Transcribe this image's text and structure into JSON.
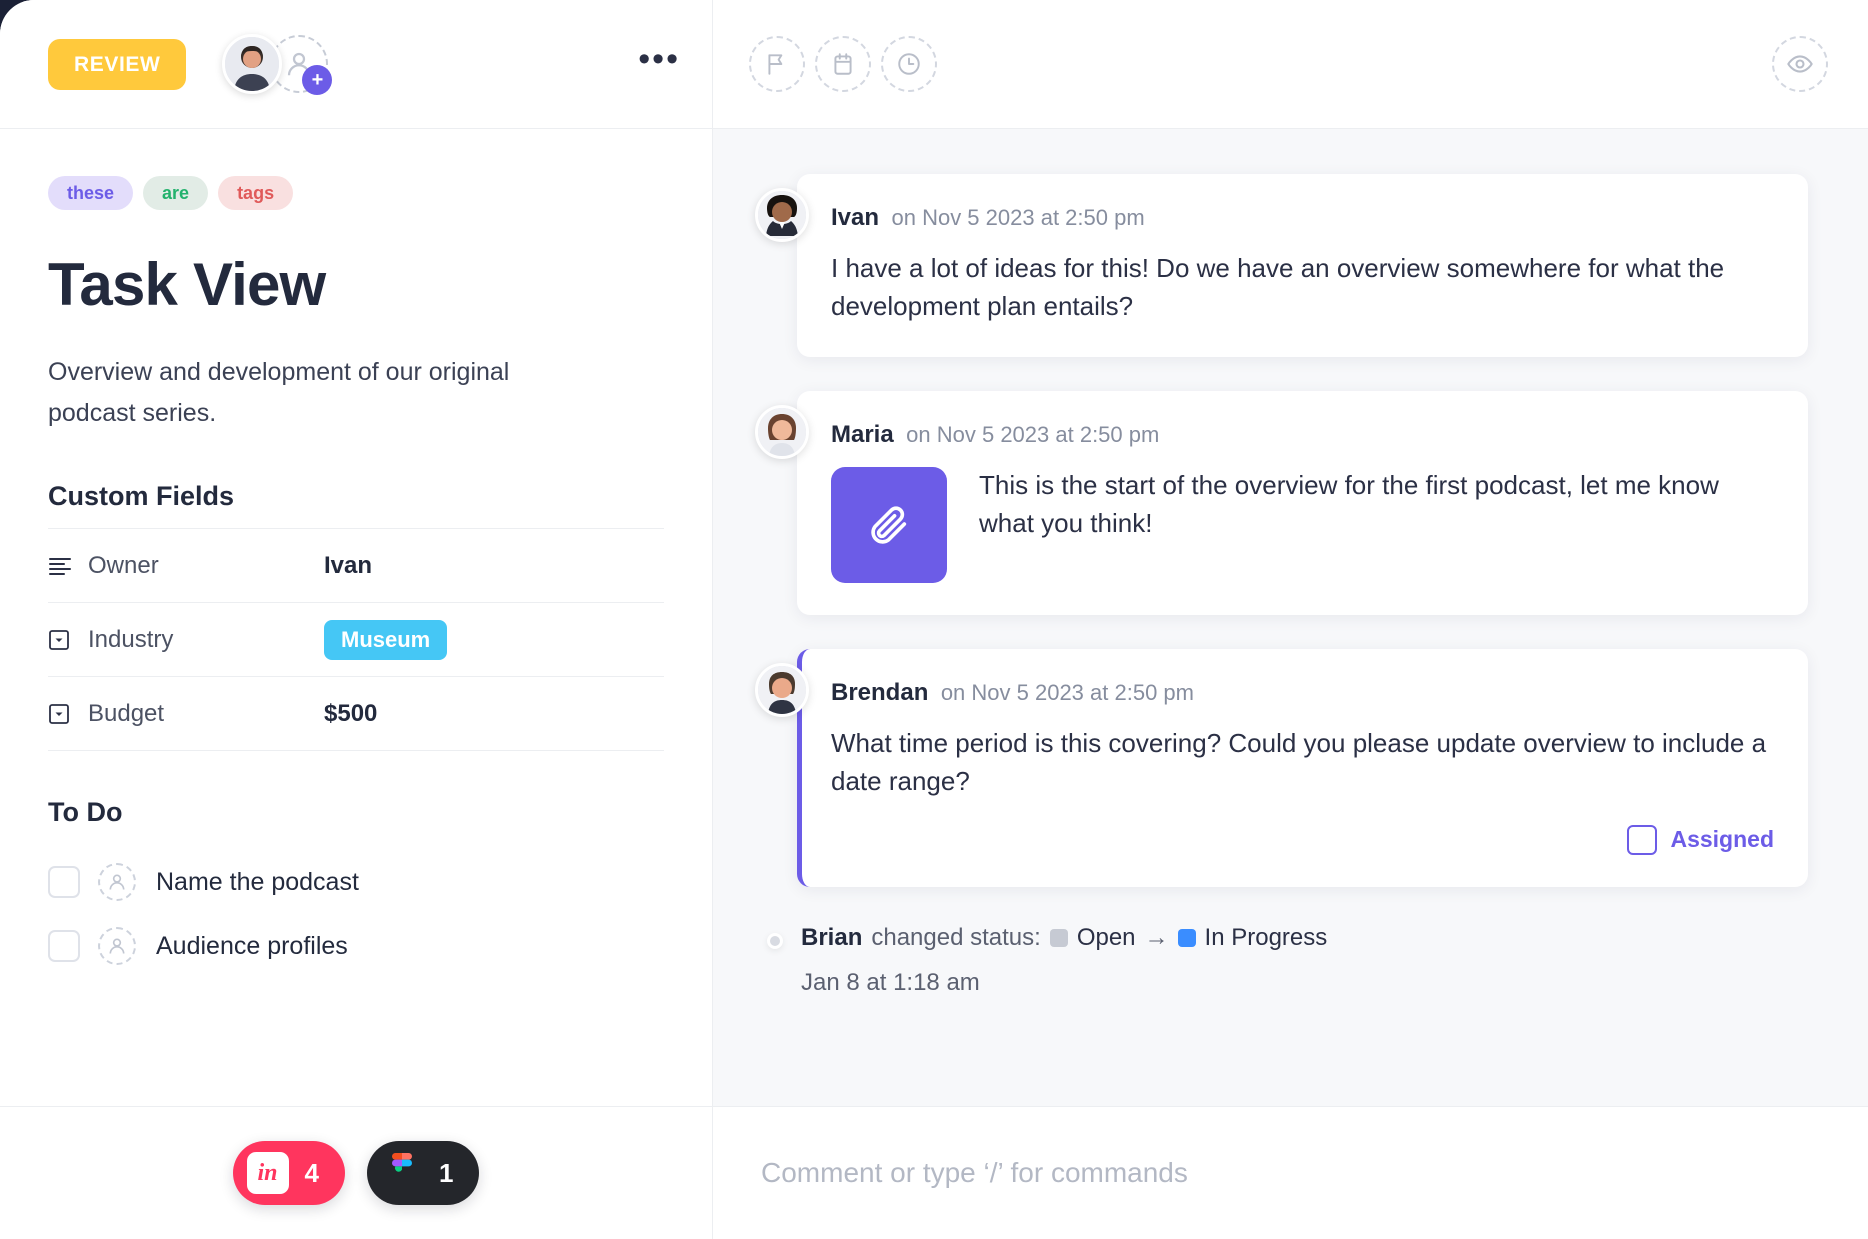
{
  "header": {
    "status_button": "REVIEW",
    "more_icon": "•••",
    "assignee_add_icon": "plus-icon",
    "tool_icons": [
      "flag-icon",
      "calendar-icon",
      "clock-icon"
    ],
    "watch_icon": "eye-icon"
  },
  "task": {
    "tags": [
      {
        "label": "these",
        "color": "#6c5ce7"
      },
      {
        "label": "are",
        "color": "#23b26d"
      },
      {
        "label": "tags",
        "color": "#e05a5a"
      }
    ],
    "title": "Task View",
    "description": "Overview and development of our original podcast series.",
    "custom_fields_heading": "Custom Fields",
    "custom_fields": [
      {
        "icon": "text-lines-icon",
        "label": "Owner",
        "value": "Ivan",
        "type": "text"
      },
      {
        "icon": "dropdown-icon",
        "label": "Industry",
        "value": "Museum",
        "type": "badge",
        "badge_color": "#45c7f5"
      },
      {
        "icon": "dropdown-icon",
        "label": "Budget",
        "value": "$500",
        "type": "text"
      }
    ],
    "todo_heading": "To Do",
    "todos": [
      {
        "label": "Name the podcast",
        "checked": false
      },
      {
        "label": "Audience profiles",
        "checked": false
      }
    ]
  },
  "integrations": [
    {
      "name": "invision",
      "mark": "in",
      "count": "4",
      "color": "#ff355e"
    },
    {
      "name": "figma",
      "mark": "figma-icon",
      "count": "1",
      "color": "#24262b"
    }
  ],
  "comments": [
    {
      "author": "Ivan",
      "time": "on Nov 5 2023 at 2:50 pm",
      "text": "I have a lot of ideas for this! Do we have an overview somewhere for what the development plan entails?",
      "attachment": false,
      "highlight": false,
      "assigned_label": null
    },
    {
      "author": "Maria",
      "time": "on Nov 5 2023 at 2:50 pm",
      "text": "This is the start of the overview for the first podcast, let me know what you think!",
      "attachment": true,
      "attachment_icon": "paperclip-icon",
      "highlight": false,
      "assigned_label": null
    },
    {
      "author": "Brendan",
      "time": "on Nov 5 2023 at 2:50 pm",
      "text": "What time period is this covering? Could you please update overview to include a date range?",
      "attachment": false,
      "highlight": true,
      "assigned_label": "Assigned"
    }
  ],
  "activity": {
    "user": "Brian",
    "action": "changed status:",
    "from_status": "Open",
    "from_color": "#c6cad3",
    "arrow": "→",
    "to_status": "In Progress",
    "to_color": "#3a8dff",
    "date": "Jan 8 at 1:18 am"
  },
  "composer": {
    "placeholder": "Comment or type ‘/’ for commands",
    "value": ""
  }
}
